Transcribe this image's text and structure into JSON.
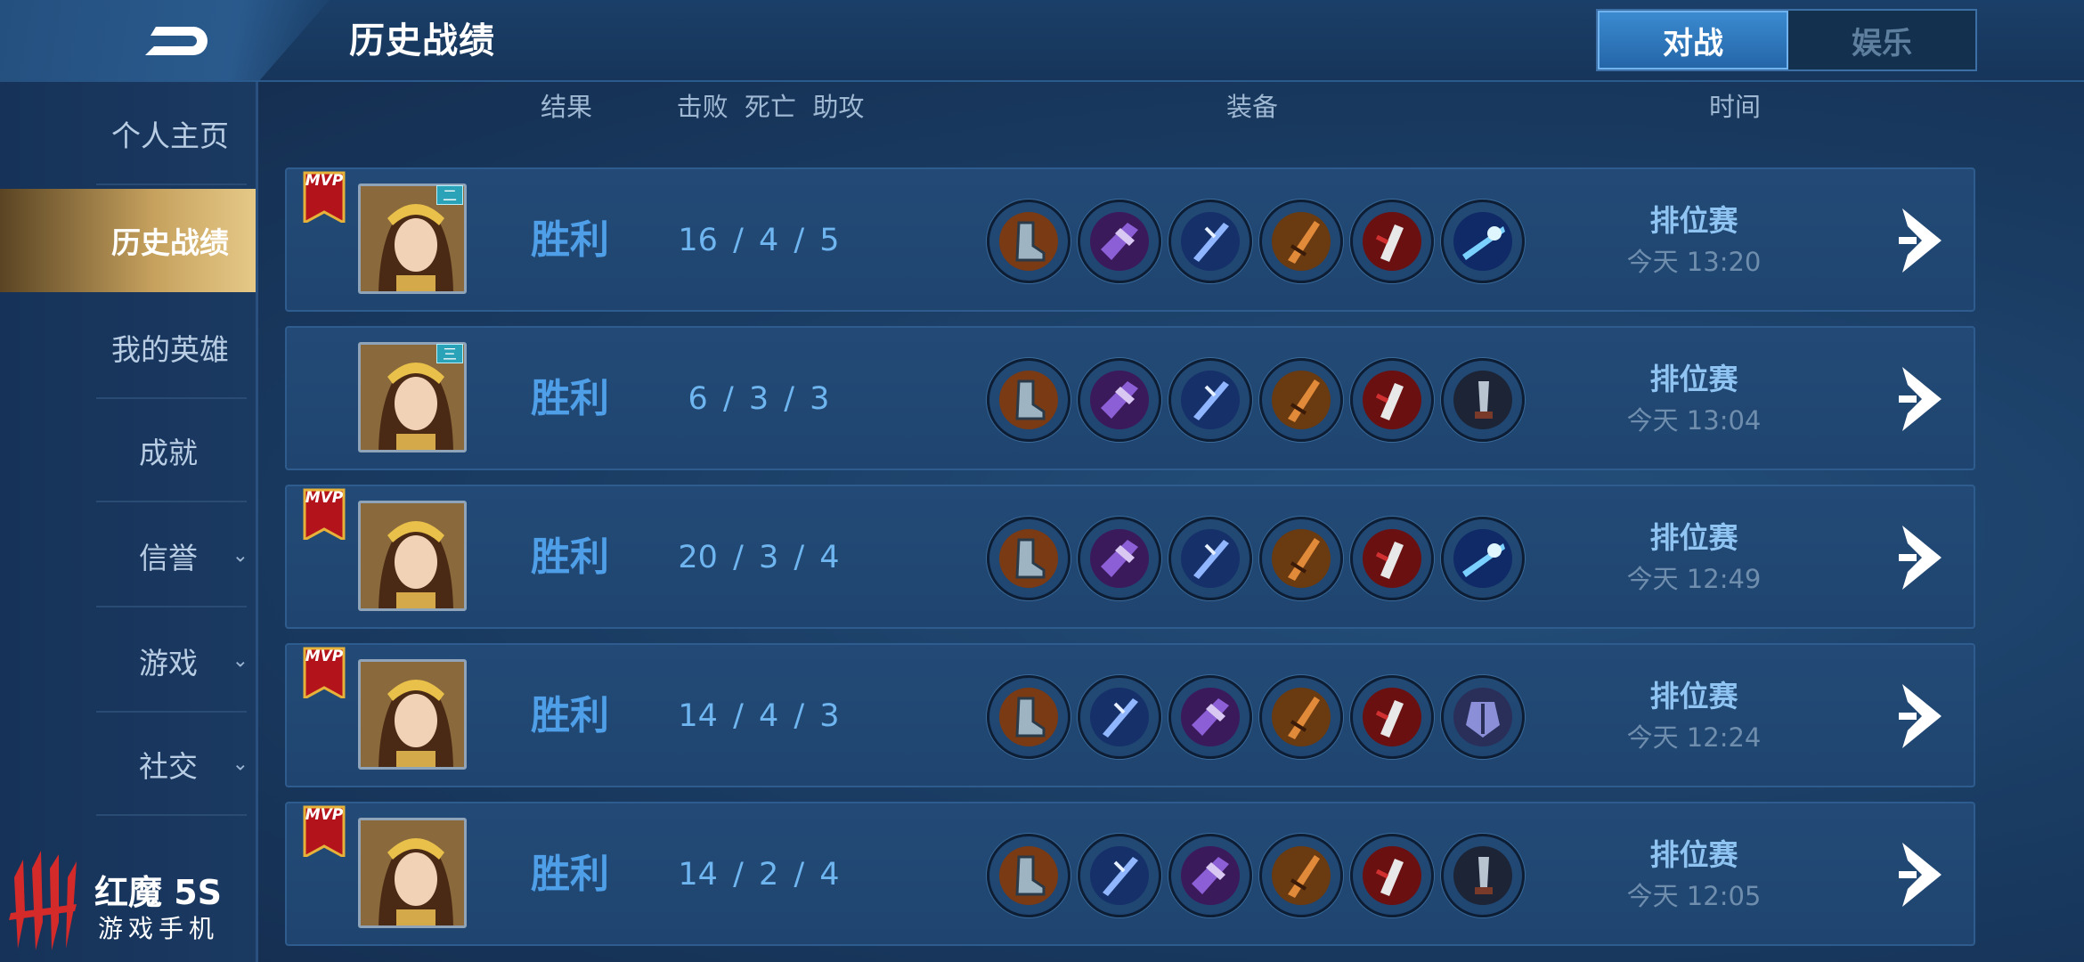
{
  "header": {
    "title": "历史战绩",
    "tabs": [
      {
        "label": "对战",
        "active": true
      },
      {
        "label": "娱乐",
        "active": false
      }
    ]
  },
  "sidebar": {
    "items": [
      {
        "label": "个人主页",
        "active": false,
        "has_chevron": false
      },
      {
        "label": "历史战绩",
        "active": true,
        "has_chevron": false
      },
      {
        "label": "我的英雄",
        "active": false,
        "has_chevron": false
      },
      {
        "label": "成就",
        "active": false,
        "has_chevron": false
      },
      {
        "label": "信誉",
        "active": false,
        "has_chevron": true
      },
      {
        "label": "游戏",
        "active": false,
        "has_chevron": true
      },
      {
        "label": "社交",
        "active": false,
        "has_chevron": true
      }
    ]
  },
  "columns": {
    "result": "结果",
    "kda": "击败  死亡  助攻",
    "equipment": "装备",
    "time": "时间"
  },
  "matches": [
    {
      "mvp": true,
      "mvp_text": "MVP",
      "tier": "二",
      "result": "胜利",
      "kda": "16 / 4 / 5",
      "mode": "排位赛",
      "time": "今天 13:20",
      "items": [
        "boots-item-icon",
        "purple-axe-item-icon",
        "blue-blade-item-icon",
        "orange-sword-item-icon",
        "red-blade-item-icon",
        "blue-spear-item-icon"
      ]
    },
    {
      "mvp": false,
      "mvp_text": "",
      "tier": "三",
      "result": "胜利",
      "kda": "6 / 3 / 3",
      "mode": "排位赛",
      "time": "今天 13:04",
      "items": [
        "boots-item-icon",
        "purple-axe-item-icon",
        "blue-blade-item-icon",
        "orange-sword-item-icon",
        "red-blade-item-icon",
        "dark-hilt-item-icon"
      ]
    },
    {
      "mvp": true,
      "mvp_text": "MVP",
      "tier": "",
      "result": "胜利",
      "kda": "20 / 3 / 4",
      "mode": "排位赛",
      "time": "今天 12:49",
      "items": [
        "boots-item-icon",
        "purple-axe-item-icon",
        "blue-blade-item-icon",
        "orange-sword-item-icon",
        "red-blade-item-icon",
        "blue-spear-item-icon"
      ]
    },
    {
      "mvp": true,
      "mvp_text": "MVP",
      "tier": "",
      "result": "胜利",
      "kda": "14 / 4 / 3",
      "mode": "排位赛",
      "time": "今天 12:24",
      "items": [
        "boots-item-icon",
        "blue-blade-item-icon",
        "purple-axe-item-icon",
        "orange-sword-item-icon",
        "red-blade-item-icon",
        "armor-item-icon"
      ]
    },
    {
      "mvp": true,
      "mvp_text": "MVP",
      "tier": "",
      "result": "胜利",
      "kda": "14 / 2 / 4",
      "mode": "排位赛",
      "time": "今天 12:05",
      "items": [
        "boots-item-icon",
        "blue-blade-item-icon",
        "purple-axe-item-icon",
        "orange-sword-item-icon",
        "red-blade-item-icon",
        "dark-hilt-item-icon"
      ]
    }
  ],
  "brand": {
    "title": "红魔 5S",
    "subtitle": "游戏手机"
  },
  "colors": {
    "accent_gold": "#c6a15e",
    "result_blue": "#4e9fe8",
    "tab_active": "#2e78c0",
    "mvp_red": "#b3141c"
  }
}
